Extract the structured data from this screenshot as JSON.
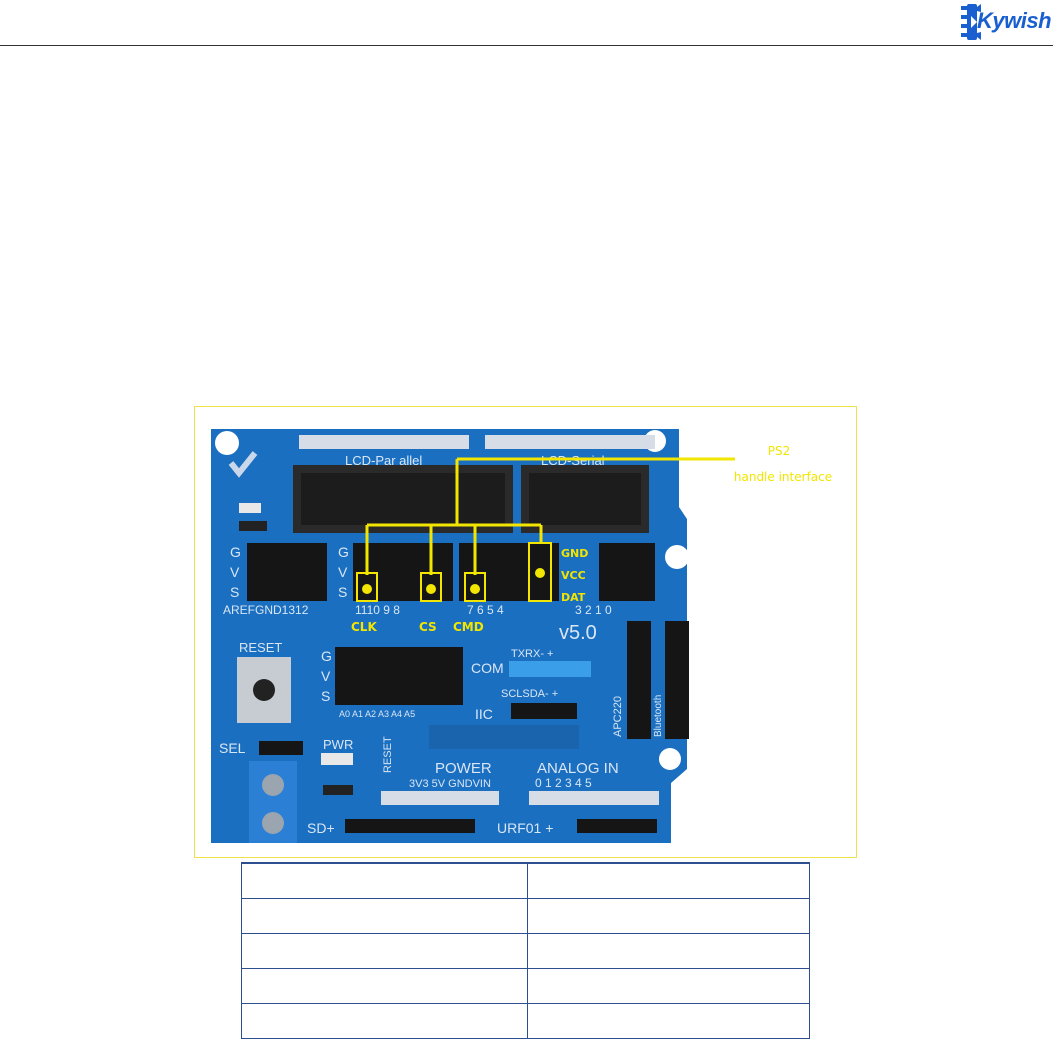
{
  "header": {
    "brand_logo_text": "Kywish",
    "brand_color": "#1a5fd0"
  },
  "figure": {
    "callout": {
      "line1": "PS2",
      "line2": "handle interface",
      "color": "#f2e600"
    },
    "pin_labels": {
      "clk": "CLK",
      "cs": "CS",
      "cmd": "CMD",
      "gnd": "GND",
      "vcc": "VCC",
      "dat": "DAT"
    },
    "board": {
      "lcd_parallel": "LCD-Par allel",
      "lcd_serial": "LCD-Serial",
      "version": "v5.0",
      "reset": "RESET",
      "com": "COM",
      "txrx": "TXRX-  +",
      "sclsda": "SCLSDA-  +",
      "iic": "IIC",
      "sel": "SEL",
      "pwr": "PWR",
      "power": "POWER",
      "power_pins": "3V3  5V GNDVIN",
      "analog_in": "ANALOG  IN",
      "analog_nums": "0 1 2 3 4 5",
      "analog_pins": "A0 A1 A2 A3 A4 A5",
      "digital_left": "AREFGND1312",
      "digital_mid": "1110 9  8",
      "digital_right": "7  6  5  4",
      "digital_far": "3  2  1  0",
      "sd": "SD+",
      "urf": "URF01 +",
      "apc": "APC220",
      "bluetooth": "Bluetooth",
      "reset_vertical": "RESET",
      "gvs_g": "G",
      "gvs_v": "V",
      "gvs_s": "S",
      "color": "#1b6fc0"
    }
  },
  "table": {
    "rows": [
      [
        "",
        ""
      ],
      [
        "",
        ""
      ],
      [
        "",
        ""
      ],
      [
        "",
        ""
      ],
      [
        "",
        ""
      ]
    ]
  }
}
